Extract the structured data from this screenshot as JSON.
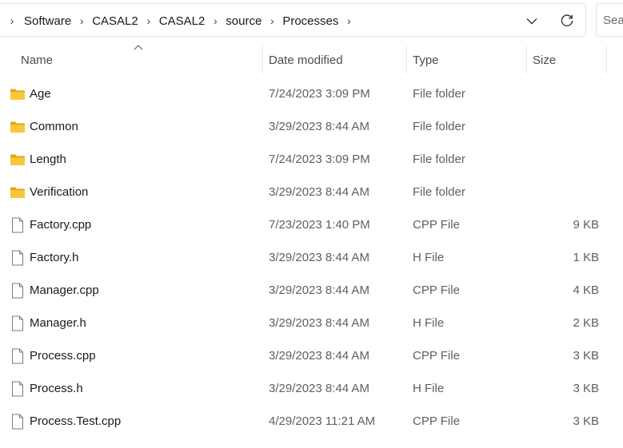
{
  "address": {
    "crumbs": [
      "Software",
      "CASAL2",
      "CASAL2",
      "source",
      "Processes"
    ],
    "lead_glyph": ")"
  },
  "search": {
    "placeholder": "Search"
  },
  "columns": {
    "name": "Name",
    "date": "Date modified",
    "type": "Type",
    "size": "Size"
  },
  "sort": {
    "column": "name",
    "direction": "ascending"
  },
  "files": [
    {
      "name": "Age",
      "date": "7/24/2023 3:09 PM",
      "type": "File folder",
      "size": "",
      "icon": "folder-icon"
    },
    {
      "name": "Common",
      "date": "3/29/2023 8:44 AM",
      "type": "File folder",
      "size": "",
      "icon": "folder-icon"
    },
    {
      "name": "Length",
      "date": "7/24/2023 3:09 PM",
      "type": "File folder",
      "size": "",
      "icon": "folder-icon"
    },
    {
      "name": "Verification",
      "date": "3/29/2023 8:44 AM",
      "type": "File folder",
      "size": "",
      "icon": "folder-icon"
    },
    {
      "name": "Factory.cpp",
      "date": "7/23/2023 1:40 PM",
      "type": "CPP File",
      "size": "9 KB",
      "icon": "file-icon"
    },
    {
      "name": "Factory.h",
      "date": "3/29/2023 8:44 AM",
      "type": "H File",
      "size": "1 KB",
      "icon": "file-icon"
    },
    {
      "name": "Manager.cpp",
      "date": "3/29/2023 8:44 AM",
      "type": "CPP File",
      "size": "4 KB",
      "icon": "file-icon"
    },
    {
      "name": "Manager.h",
      "date": "3/29/2023 8:44 AM",
      "type": "H File",
      "size": "2 KB",
      "icon": "file-icon"
    },
    {
      "name": "Process.cpp",
      "date": "3/29/2023 8:44 AM",
      "type": "CPP File",
      "size": "3 KB",
      "icon": "file-icon"
    },
    {
      "name": "Process.h",
      "date": "3/29/2023 8:44 AM",
      "type": "H File",
      "size": "3 KB",
      "icon": "file-icon"
    },
    {
      "name": "Process.Test.cpp",
      "date": "4/29/2023 11:21 AM",
      "type": "CPP File",
      "size": "3 KB",
      "icon": "file-icon"
    }
  ],
  "colors": {
    "folder": "#f8c73c",
    "folder_dark": "#e8a317",
    "file_outline": "#7a7a7a",
    "text_secondary": "#5f5f5f"
  }
}
